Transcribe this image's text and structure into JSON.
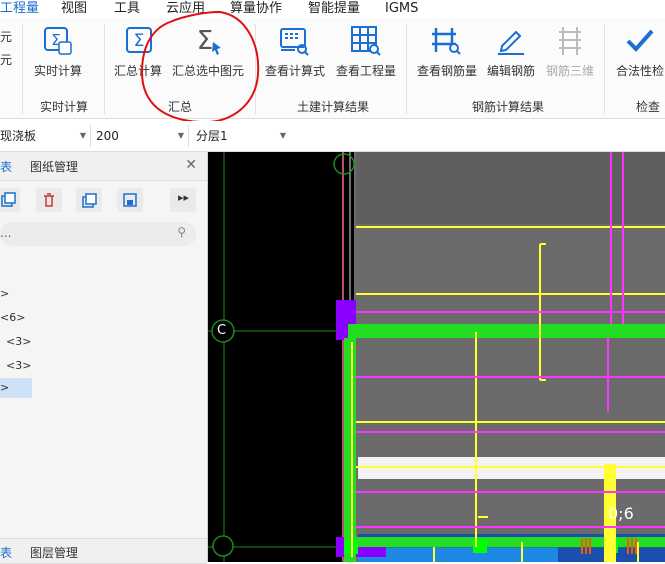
{
  "menu": [
    "工程量",
    "视图",
    "工具",
    "云应用",
    "算量协作",
    "智能提量",
    "IGMS"
  ],
  "ribbon": {
    "left_cut": [
      "元",
      "元"
    ],
    "buttons": {
      "realtime": "实时计算",
      "summary": "汇总计算",
      "summary_selected": "汇总选中图元",
      "view_formula": "查看计算式",
      "view_quantity": "查看工程量",
      "view_rebar": "查看钢筋量",
      "edit_rebar": "编辑钢筋",
      "rebar_3d": "钢筋三维",
      "legality_check": "合法性检"
    },
    "groups": {
      "realtime": "实时计算",
      "summary": "汇总",
      "civil": "土建计算结果",
      "rebar": "钢筋计算结果",
      "check": "检查"
    }
  },
  "toolbar": {
    "component_type": "现浇板",
    "value": "200",
    "layer": "分层1"
  },
  "left_panel": {
    "top_tabs": [
      "表",
      "图纸管理"
    ],
    "bottom_tabs": [
      "表",
      "图层管理"
    ],
    "search_placeholder": "...",
    "tree": [
      ">",
      "<6>",
      "<3>",
      "<3>",
      ">"
    ]
  },
  "canvas": {
    "axis_labels": [
      "C"
    ],
    "annotation": "0;6"
  },
  "colors": {
    "accent": "#1a6fd0",
    "annotation_red": "#e01010",
    "slab_gray": "#6b6b6b",
    "beam_green": "#22dd22",
    "rebar_yellow": "#ffff33",
    "rebar_magenta": "#ff33ff"
  }
}
